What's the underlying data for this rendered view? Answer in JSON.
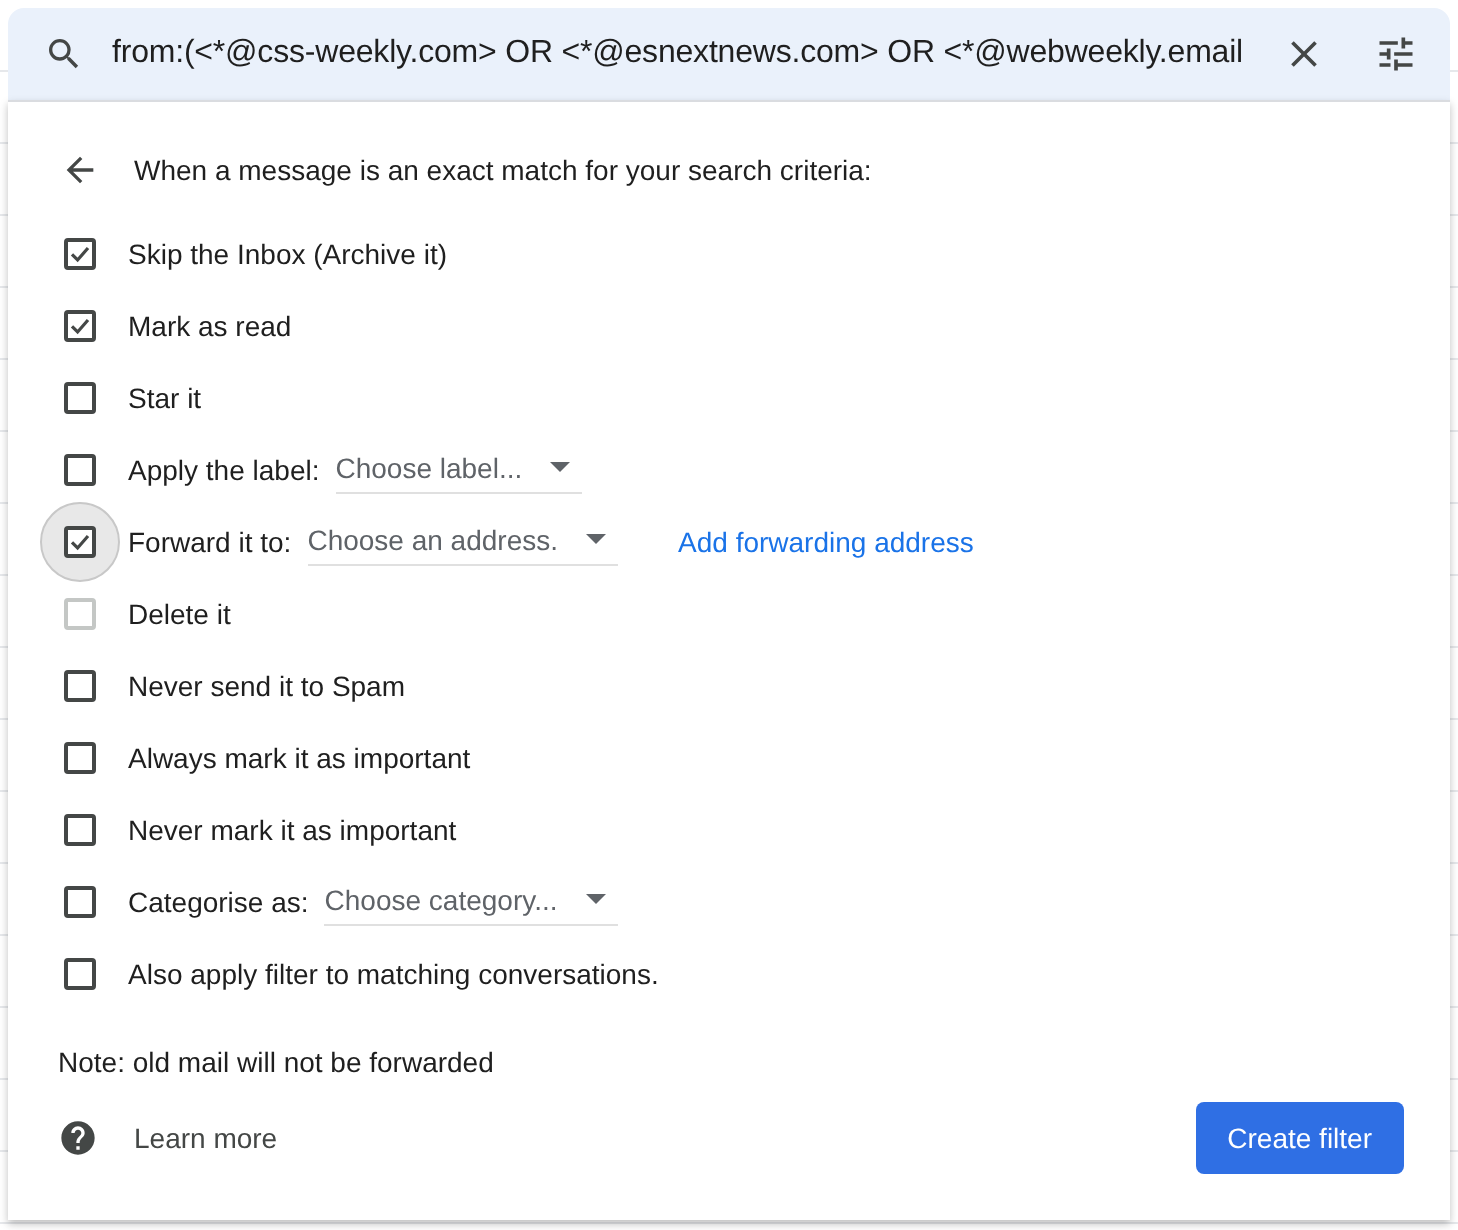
{
  "search": {
    "value": "from:(<*@css-weekly.com> OR <*@esnextnews.com> OR <*@webweekly.email"
  },
  "heading": "When a message is an exact match for your search criteria:",
  "options": [
    {
      "kind": "plain",
      "label": "Skip the Inbox (Archive it)",
      "checked": true,
      "disabled": false,
      "focused": false
    },
    {
      "kind": "plain",
      "label": "Mark as read",
      "checked": true,
      "disabled": false,
      "focused": false
    },
    {
      "kind": "plain",
      "label": "Star it",
      "checked": false,
      "disabled": false,
      "focused": false
    },
    {
      "kind": "select",
      "label": "Apply the label:",
      "select": "Choose label...",
      "checked": false,
      "disabled": false,
      "focused": false
    },
    {
      "kind": "select",
      "label": "Forward it to:",
      "select": "Choose an address.",
      "link": "Add forwarding address",
      "checked": true,
      "disabled": false,
      "focused": true
    },
    {
      "kind": "plain",
      "label": "Delete it",
      "checked": false,
      "disabled": true,
      "focused": false
    },
    {
      "kind": "plain",
      "label": "Never send it to Spam",
      "checked": false,
      "disabled": false,
      "focused": false
    },
    {
      "kind": "plain",
      "label": "Always mark it as important",
      "checked": false,
      "disabled": false,
      "focused": false
    },
    {
      "kind": "plain",
      "label": "Never mark it as important",
      "checked": false,
      "disabled": false,
      "focused": false
    },
    {
      "kind": "select",
      "label": "Categorise as:",
      "select": "Choose category...",
      "checked": false,
      "disabled": false,
      "focused": false
    },
    {
      "kind": "plain",
      "label": "Also apply filter to matching conversations.",
      "checked": false,
      "disabled": false,
      "focused": false
    }
  ],
  "note": "Note: old mail will not be forwarded",
  "learn_more": "Learn more",
  "create_button": "Create filter"
}
